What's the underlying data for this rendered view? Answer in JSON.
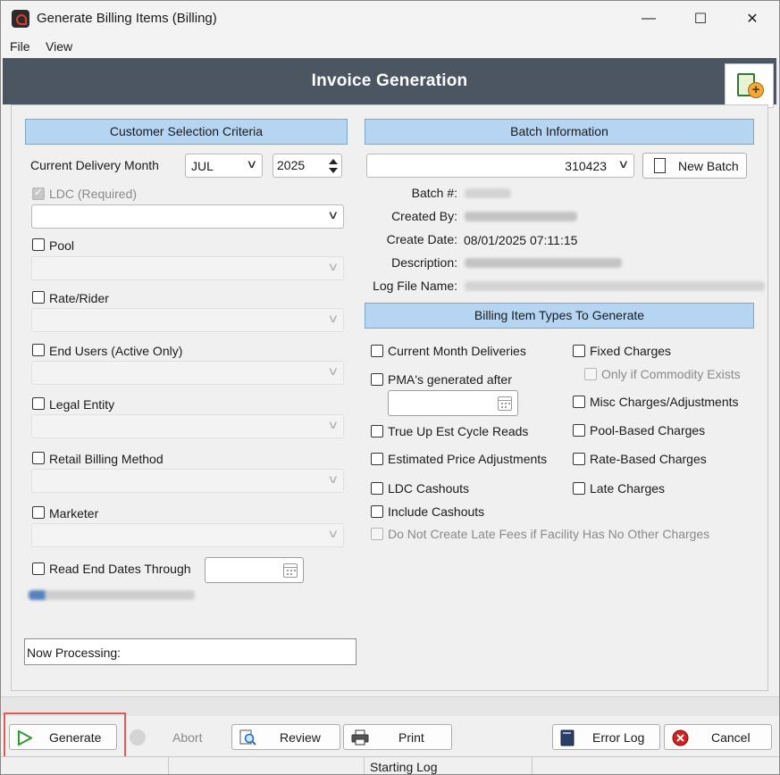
{
  "window": {
    "title": "Generate Billing Items (Billing)",
    "minimize": "—",
    "maximize": "☐",
    "close": "✕"
  },
  "menu": {
    "file": "File",
    "view": "View"
  },
  "header": {
    "title": "Invoice Generation"
  },
  "customer": {
    "heading": "Customer Selection Criteria",
    "delivery_month_label": "Current Delivery Month",
    "month_value": "JUL",
    "year_value": "2025",
    "ldc_label": "LDC (Required)",
    "pool_label": "Pool",
    "rate_rider_label": "Rate/Rider",
    "end_users_label": "End Users (Active Only)",
    "legal_entity_label": "Legal Entity",
    "retail_billing_label": "Retail Billing Method",
    "marketer_label": "Marketer",
    "read_end_dates_label": "Read End Dates Through",
    "now_processing_label": "Now Processing:"
  },
  "batch": {
    "heading": "Batch Information",
    "batch_selected": "310423",
    "new_batch_label": "New Batch",
    "batch_no_label": "Batch #:",
    "created_by_label": "Created By:",
    "create_date_label": "Create Date:",
    "create_date_value": "08/01/2025 07:11:15",
    "description_label": "Description:",
    "log_file_label": "Log File Name:"
  },
  "billing_types": {
    "heading": "Billing Item Types To Generate",
    "current_month": "Current Month Deliveries",
    "pma_after": "PMA's generated after",
    "true_up": "True Up Est Cycle Reads",
    "est_price": "Estimated Price Adjustments",
    "ldc_cashouts": "LDC Cashouts",
    "include_cashouts": "Include Cashouts",
    "no_late_fees": "Do Not Create Late Fees if Facility Has No Other Charges",
    "fixed_charges": "Fixed Charges",
    "only_commodity": "Only if Commodity Exists",
    "misc_charges": "Misc Charges/Adjustments",
    "pool_based": "Pool-Based Charges",
    "rate_based": "Rate-Based Charges",
    "late_charges": "Late Charges"
  },
  "buttons": {
    "generate": "Generate",
    "abort": "Abort",
    "review": "Review",
    "print": "Print",
    "error_log": "Error Log",
    "cancel": "Cancel"
  },
  "status": {
    "text": "Starting Log"
  },
  "colors": {
    "header_band": "#4c5562",
    "section_head": "#b6d5f3",
    "highlight": "#e05a5a",
    "generate_icon": "#2e9b2e",
    "cancel_icon": "#d62020"
  }
}
